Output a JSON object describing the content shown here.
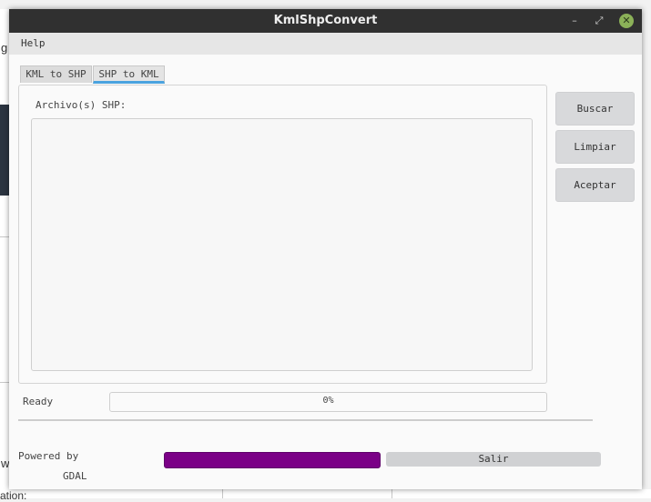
{
  "window": {
    "title": "KmlShpConvert",
    "minimize_glyph": "–",
    "maximize_glyph": "⤢",
    "close_glyph": "✕"
  },
  "menu": {
    "help": "Help"
  },
  "tabs": [
    {
      "label": "KML to SHP",
      "active": false
    },
    {
      "label": "SHP to KML",
      "active": true
    }
  ],
  "panel": {
    "label": "Archivo(s) SHP:"
  },
  "buttons": {
    "search": "Buscar",
    "clear": "Limpiar",
    "accept": "Aceptar",
    "exit": "Salir"
  },
  "status": {
    "text": "Ready",
    "progress_text": "0%",
    "progress_fraction": 0
  },
  "footer": {
    "powered_by": "Powered by",
    "gdal": "GDAL"
  },
  "background": {
    "fragments": [
      "g",
      "w",
      "ation:"
    ]
  },
  "colors": {
    "accent": "#4aa3df",
    "bar": "#7b0087",
    "titlebar": "#303030",
    "close": "#8bb158"
  }
}
